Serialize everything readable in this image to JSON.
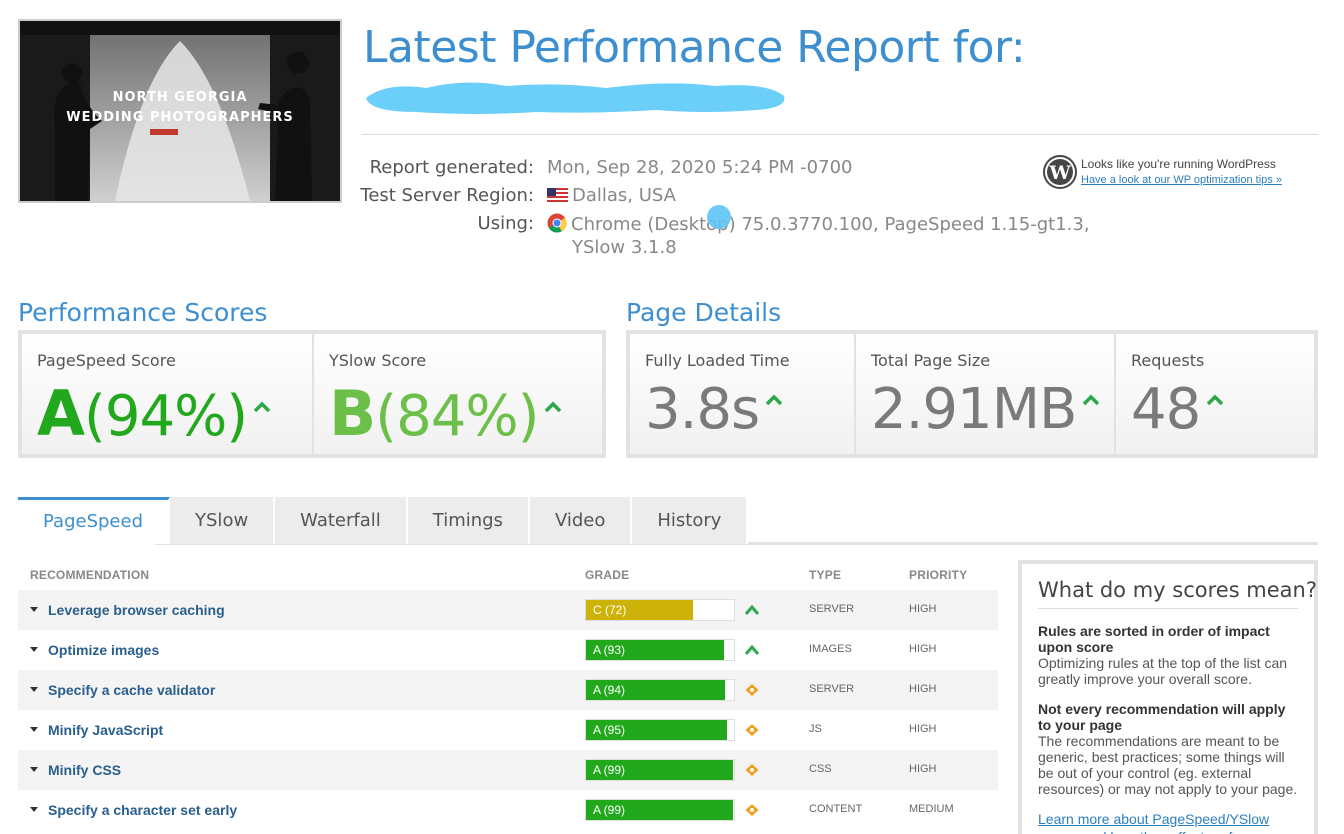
{
  "header": {
    "title": "Latest Performance Report for:",
    "thumbnail": {
      "text_line1": "NORTH GEORGIA",
      "text_line2": "WEDDING PHOTOGRAPHERS"
    }
  },
  "meta": {
    "report_generated_label": "Report generated:",
    "report_generated_value": "Mon, Sep 28, 2020 5:24 PM -0700",
    "region_label": "Test Server Region:",
    "region_value": "Dallas, USA",
    "using_label": "Using:",
    "using_value_line1": "Chrome (Desktop) 75.0.3770.100, PageSpeed 1.15-gt1.3,",
    "using_value_line2": "YSlow 3.1.8"
  },
  "wordpress": {
    "text": "Looks like you're running WordPress",
    "link": "Have a look at our WP optimization tips »"
  },
  "performance_scores": {
    "title": "Performance Scores",
    "pagespeed": {
      "label": "PageSpeed Score",
      "grade": "A",
      "percent": "(94%)"
    },
    "yslow": {
      "label": "YSlow Score",
      "grade": "B",
      "percent": "(84%)"
    }
  },
  "page_details": {
    "title": "Page Details",
    "load_time": {
      "label": "Fully Loaded Time",
      "value": "3.8s"
    },
    "page_size": {
      "label": "Total Page Size",
      "value": "2.91MB"
    },
    "requests": {
      "label": "Requests",
      "value": "48"
    }
  },
  "tabs": [
    "PageSpeed",
    "YSlow",
    "Waterfall",
    "Timings",
    "Video",
    "History"
  ],
  "active_tab": "PageSpeed",
  "table": {
    "headers": {
      "recommendation": "RECOMMENDATION",
      "grade": "GRADE",
      "type": "TYPE",
      "priority": "PRIORITY"
    },
    "rows": [
      {
        "name": "Leverage browser caching",
        "grade": "C (72)",
        "score": 72,
        "trend": "up",
        "type": "SERVER",
        "priority": "HIGH"
      },
      {
        "name": "Optimize images",
        "grade": "A (93)",
        "score": 93,
        "trend": "up",
        "type": "IMAGES",
        "priority": "HIGH"
      },
      {
        "name": "Specify a cache validator",
        "grade": "A (94)",
        "score": 94,
        "trend": "same",
        "type": "SERVER",
        "priority": "HIGH"
      },
      {
        "name": "Minify JavaScript",
        "grade": "A (95)",
        "score": 95,
        "trend": "same",
        "type": "JS",
        "priority": "HIGH"
      },
      {
        "name": "Minify CSS",
        "grade": "A (99)",
        "score": 99,
        "trend": "same",
        "type": "CSS",
        "priority": "HIGH"
      },
      {
        "name": "Specify a character set early",
        "grade": "A (99)",
        "score": 99,
        "trend": "same",
        "type": "CONTENT",
        "priority": "MEDIUM"
      }
    ]
  },
  "sidebar": {
    "title": "What do my scores mean?",
    "h1": "Rules are sorted in order of impact upon score",
    "p1": "Optimizing rules at the top of the list can greatly improve your overall score.",
    "h2": "Not every recommendation will apply to your page",
    "p2": "The recommendations are meant to be generic, best practices; some things will be out of your control (eg. external resources) or may not apply to your page.",
    "link": "Learn more about PageSpeed/YSlow scores and how they affect performance."
  },
  "colors": {
    "accent": "#3d8fd0",
    "grade_a": "#22a81c",
    "grade_b": "#6cc04a",
    "grade_c": "#cdb20a",
    "trend_up": "#2aa84a",
    "trend_same": "#f0a020",
    "gray_value": "#7a7a7a"
  }
}
